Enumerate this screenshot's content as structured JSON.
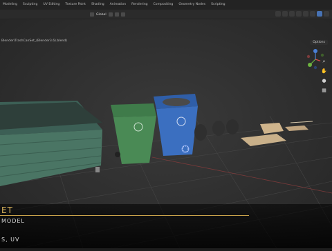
{
  "workspace_tabs": [
    {
      "label": "Modeling",
      "active": false
    },
    {
      "label": "Sculpting",
      "active": false
    },
    {
      "label": "UV Editing",
      "active": false
    },
    {
      "label": "Texture Paint",
      "active": false
    },
    {
      "label": "Shading",
      "active": false
    },
    {
      "label": "Animation",
      "active": false
    },
    {
      "label": "Rendering",
      "active": false
    },
    {
      "label": "Compositing",
      "active": false
    },
    {
      "label": "Geometry Nodes",
      "active": false
    },
    {
      "label": "Scripting",
      "active": false
    }
  ],
  "header": {
    "transform_orientation": "Global"
  },
  "viewport": {
    "file_path": "Blender\\TrashCanSet_(Blender3.6).blend)",
    "options_label": "Options"
  },
  "overlay": {
    "title_fragment": "ET",
    "subtitle": "MODEL",
    "features": "S, UV"
  },
  "colors": {
    "accent": "#d8b25a",
    "active_button": "#4772b3",
    "axis_x": "#e0474a",
    "axis_y": "#6db33f",
    "axis_z": "#4a7fd6"
  },
  "icons": {
    "nav": [
      "zoom-icon",
      "pan-hand-icon",
      "camera-icon",
      "grid-icon"
    ]
  }
}
